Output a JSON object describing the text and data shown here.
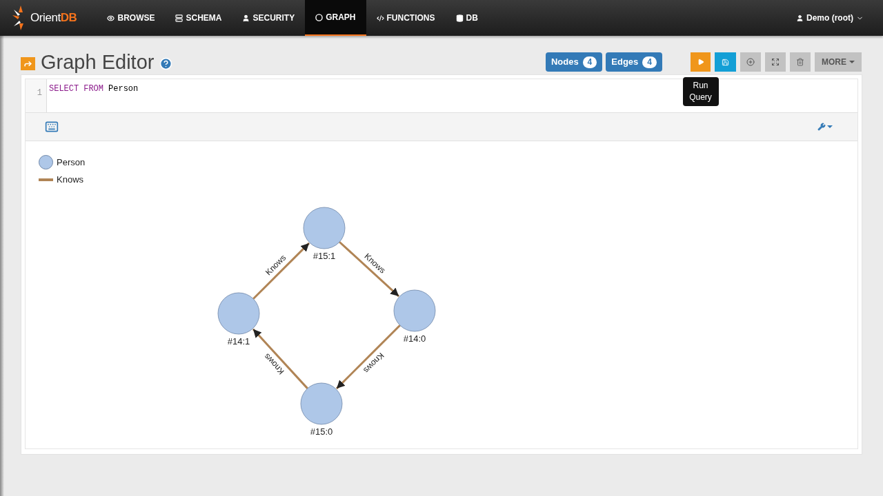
{
  "brand": {
    "name_light": "Orient",
    "name_bold": "DB"
  },
  "nav": [
    {
      "label": "BROWSE",
      "selected": false
    },
    {
      "label": "SCHEMA",
      "selected": false
    },
    {
      "label": "SECURITY",
      "selected": false
    },
    {
      "label": "GRAPH",
      "selected": true
    },
    {
      "label": "FUNCTIONS",
      "selected": false
    },
    {
      "label": "DB",
      "selected": false
    }
  ],
  "user_menu": {
    "label": "Demo (root)"
  },
  "page": {
    "title": "Graph Editor"
  },
  "counters": [
    {
      "label": "Nodes",
      "count": "4"
    },
    {
      "label": "Edges",
      "count": "4"
    }
  ],
  "toolbar": [
    {
      "kind": "run",
      "tooltip": "Run Query"
    },
    {
      "kind": "save"
    },
    {
      "kind": "add"
    },
    {
      "kind": "expand"
    },
    {
      "kind": "trash"
    },
    {
      "kind": "more",
      "label": "MORE"
    }
  ],
  "editor": {
    "line_number": "1",
    "tokens": [
      {
        "text": "SELECT",
        "kind": "keyword"
      },
      {
        "text": "FROM",
        "kind": "keyword"
      },
      {
        "text": "Person",
        "kind": "plain"
      }
    ]
  },
  "legend": [
    {
      "label": "Person",
      "kind": "node",
      "color": "#aec7e8"
    },
    {
      "label": "Knows",
      "kind": "edge",
      "color": "#b08455"
    }
  ],
  "graph": {
    "nodes": [
      {
        "label": "#15:1"
      },
      {
        "label": "#14:0"
      },
      {
        "label": "#15:0"
      },
      {
        "label": "#14:1"
      }
    ],
    "edges": [
      {
        "label": "Knows"
      },
      {
        "label": "Knows"
      },
      {
        "label": "Knows"
      },
      {
        "label": "Knows"
      }
    ]
  }
}
